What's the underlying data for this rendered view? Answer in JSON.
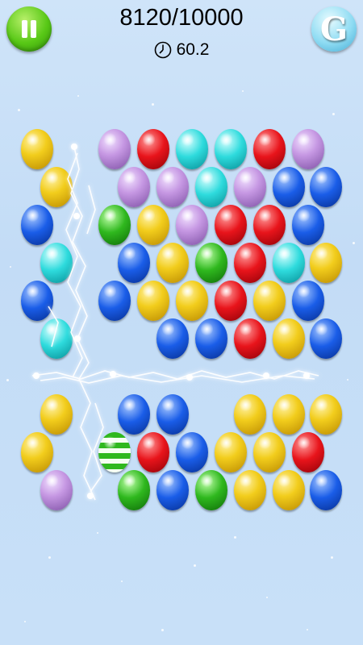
{
  "hud": {
    "score": "8120/10000",
    "timer": "60.2",
    "hint_letter": "G",
    "pause_icon": "pause-icon",
    "timer_icon": "clock-icon"
  },
  "colors": {
    "yellow": "#f2cd1c",
    "purple": "#c698e3",
    "red": "#e8141b",
    "cyan": "#2edbdd",
    "blue": "#1a5de8",
    "green": "#2fb81e",
    "background": "#c8e0f8"
  },
  "board": {
    "rows": [
      [
        "yellow",
        null,
        "purple",
        "red",
        "cyan",
        "cyan",
        "red",
        "purple"
      ],
      [
        "yellow",
        null,
        "purple",
        "purple",
        "cyan",
        "purple",
        "blue",
        "blue"
      ],
      [
        "blue",
        null,
        "green",
        "yellow",
        "purple",
        "red",
        "red",
        "blue"
      ],
      [
        "cyan",
        null,
        "blue",
        "yellow",
        "green",
        "red",
        "cyan",
        "yellow"
      ],
      [
        "blue",
        null,
        "blue",
        "yellow",
        "yellow",
        "red",
        "yellow",
        "blue"
      ],
      [
        "cyan",
        null,
        null,
        "blue",
        "blue",
        "red",
        "yellow",
        "blue"
      ],
      [
        null,
        null,
        null,
        null,
        null,
        null,
        null,
        null
      ],
      [
        "yellow",
        null,
        "blue",
        "blue",
        null,
        "yellow",
        "yellow",
        "yellow"
      ],
      [
        "yellow",
        null,
        "striped-green",
        "red",
        "blue",
        "yellow",
        "yellow",
        "red"
      ],
      [
        "purple",
        null,
        "green",
        "blue",
        "green",
        "yellow",
        "yellow",
        "blue"
      ]
    ]
  }
}
